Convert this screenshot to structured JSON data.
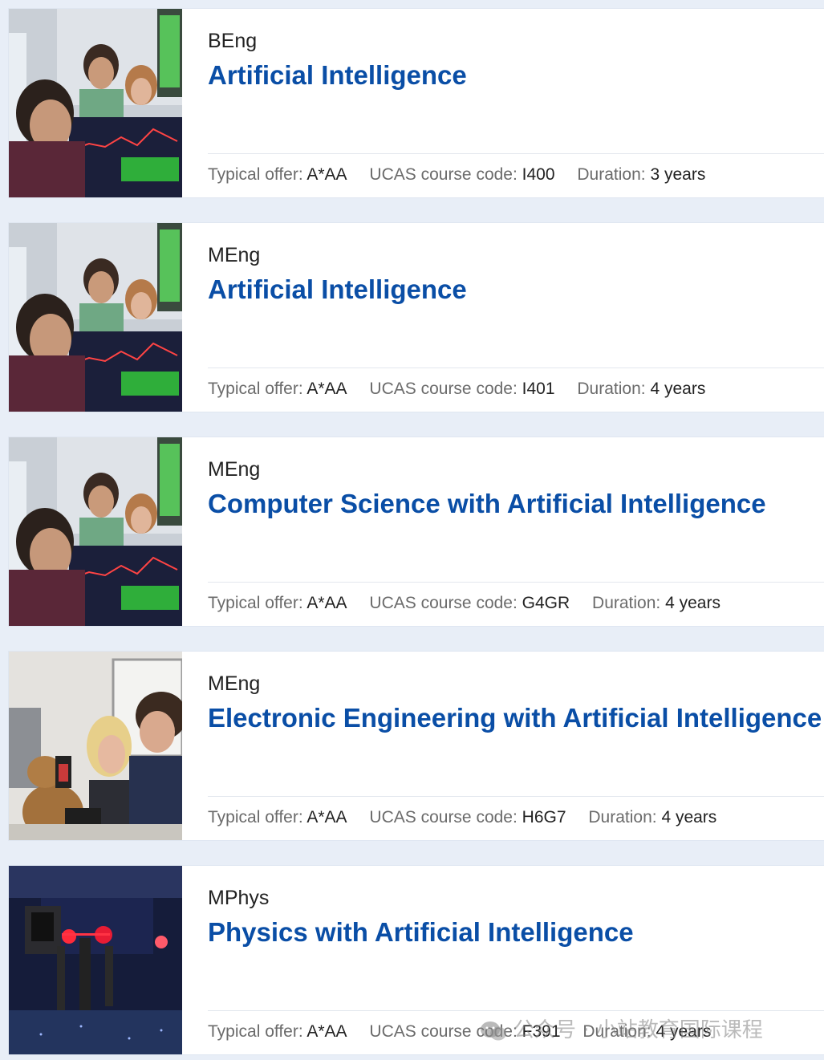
{
  "labels": {
    "typical_offer": "Typical offer:",
    "ucas_code": "UCAS course code:",
    "duration": "Duration:"
  },
  "courses": [
    {
      "degree": "BEng",
      "title": "Artificial Intelligence",
      "offer": "A*AA",
      "code": "I400",
      "duration": "3 years",
      "image": "trading-floor-students"
    },
    {
      "degree": "MEng",
      "title": "Artificial Intelligence",
      "offer": "A*AA",
      "code": "I401",
      "duration": "4 years",
      "image": "trading-floor-students"
    },
    {
      "degree": "MEng",
      "title": "Computer Science with Artificial Intelligence",
      "offer": "A*AA",
      "code": "G4GR",
      "duration": "4 years",
      "image": "trading-floor-students"
    },
    {
      "degree": "MEng",
      "title": "Electronic Engineering with Artificial Intelligence",
      "offer": "A*AA",
      "code": "H6G7",
      "duration": "4 years",
      "image": "electronics-lab-students"
    },
    {
      "degree": "MPhys",
      "title": "Physics with Artificial Intelligence",
      "offer": "A*AA",
      "code": "F391",
      "duration": "4 years",
      "image": "laser-optics-lab"
    }
  ],
  "watermark": {
    "text": "公众号 · 小站教育国际课程",
    "icon": "wechat-icon"
  },
  "colors": {
    "title": "#0a4ea6",
    "label": "#6b6b6b",
    "value": "#222222",
    "background": "#e8eef7"
  }
}
